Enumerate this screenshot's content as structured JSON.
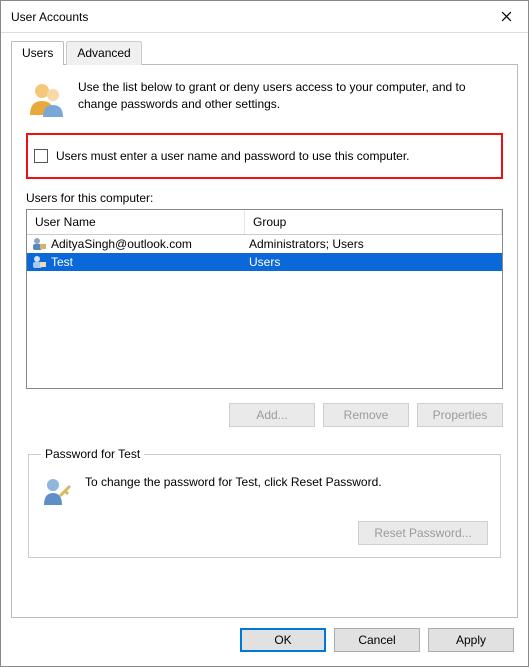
{
  "window": {
    "title": "User Accounts"
  },
  "tabs": {
    "users": "Users",
    "advanced": "Advanced"
  },
  "intro": "Use the list below to grant or deny users access to your computer, and to change passwords and other settings.",
  "checkbox": {
    "label": "Users must enter a user name and password to use this computer.",
    "checked": false
  },
  "list": {
    "caption": "Users for this computer:",
    "columns": {
      "user": "User Name",
      "group": "Group"
    },
    "rows": [
      {
        "user": "AdityaSingh@outlook.com",
        "group": "Administrators; Users",
        "selected": false
      },
      {
        "user": "Test",
        "group": "Users",
        "selected": true
      }
    ]
  },
  "buttons": {
    "add": "Add...",
    "remove": "Remove",
    "properties": "Properties"
  },
  "password": {
    "legend": "Password for Test",
    "text": "To change the password for Test, click Reset Password.",
    "reset": "Reset Password..."
  },
  "dialog": {
    "ok": "OK",
    "cancel": "Cancel",
    "apply": "Apply"
  }
}
